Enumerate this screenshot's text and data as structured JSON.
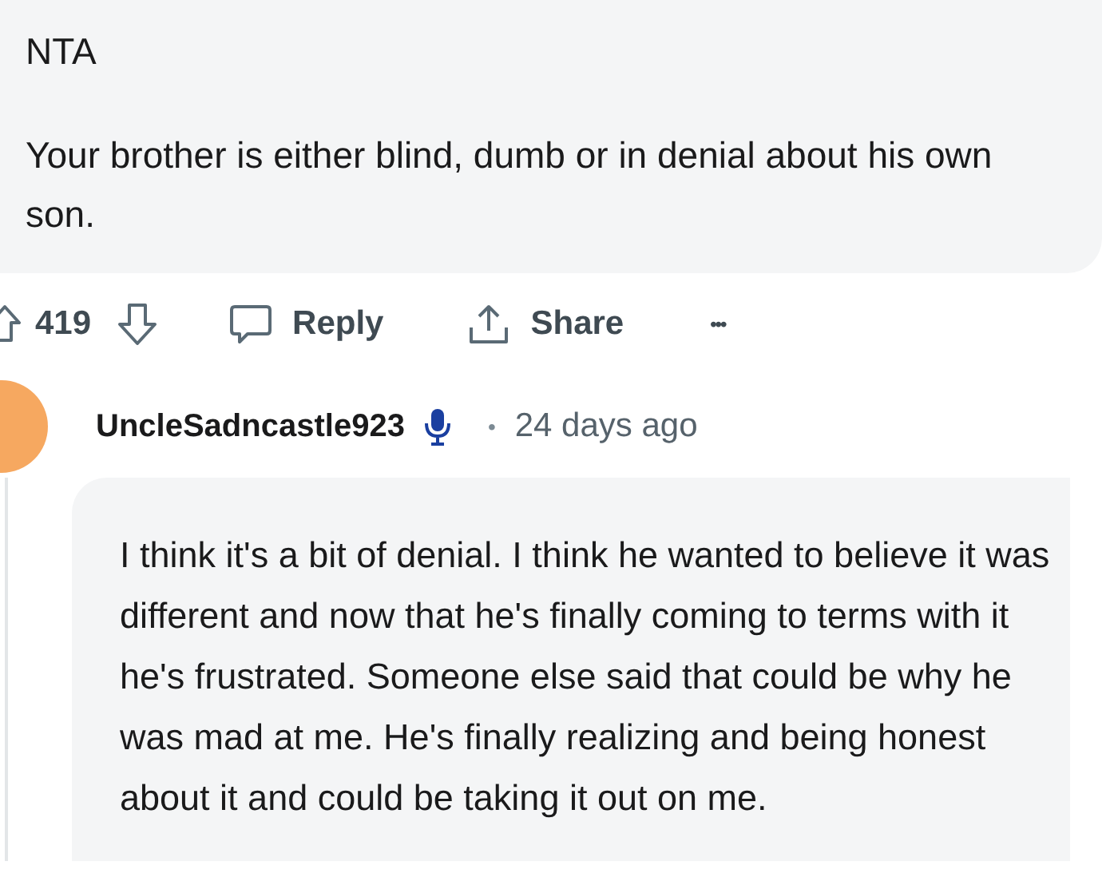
{
  "comment": {
    "paragraphs": [
      "NTA",
      "Your brother is either blind, dumb or in denial about his own son."
    ],
    "actions": {
      "score": "419",
      "reply": "Reply",
      "share": "Share",
      "more": "•••"
    }
  },
  "reply": {
    "username": "UncleSadncastle923",
    "separator": "•",
    "time": "24 days ago",
    "body": "I think it's a bit of denial. I think he wanted to believe it was different and now that he's finally coming to terms with it he's frustrated. Someone else said that could be why he was mad at me. He's finally realizing and being honest about it and could be taking it out on me."
  }
}
